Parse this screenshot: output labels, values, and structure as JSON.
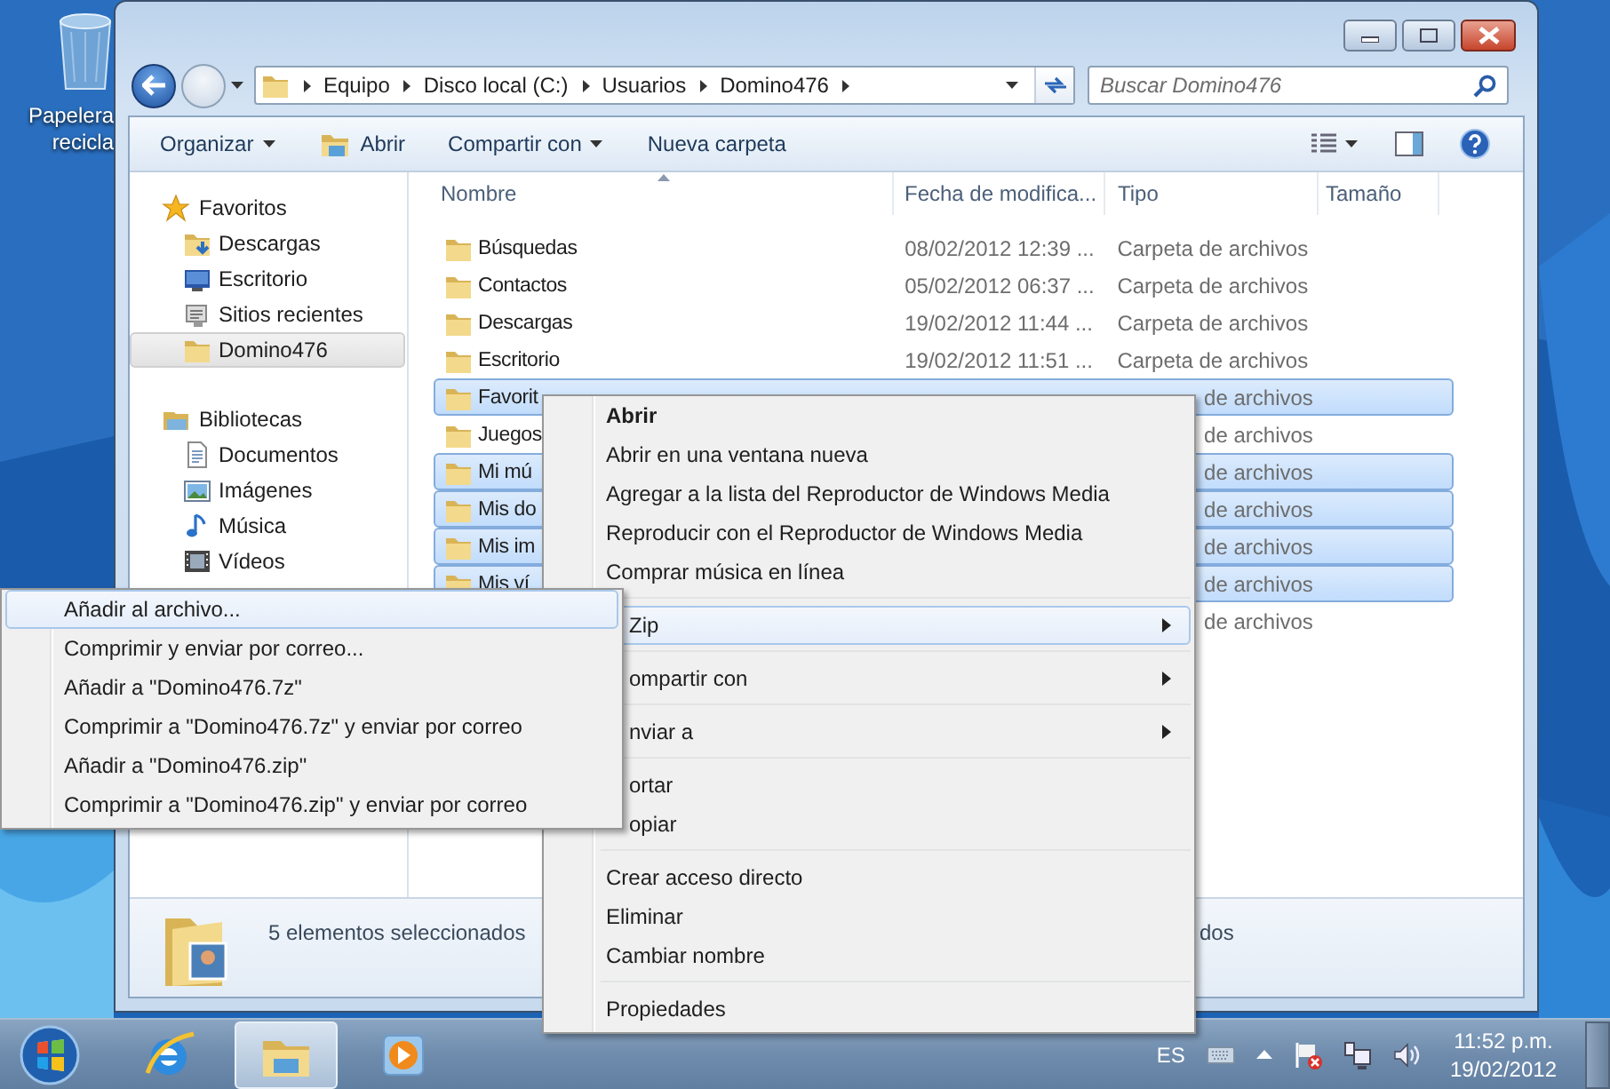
{
  "desktop": {
    "icons": [
      {
        "label": "Papelera recicla"
      }
    ]
  },
  "window": {
    "address": {
      "crumbs": [
        "Equipo",
        "Disco local (C:)",
        "Usuarios",
        "Domino476"
      ]
    },
    "search": {
      "placeholder": "Buscar Domino476"
    },
    "toolbar": [
      {
        "label": "Organizar",
        "kind": "menu"
      },
      {
        "label": "Abrir",
        "kind": "open"
      },
      {
        "label": "Compartir con",
        "kind": "menu"
      },
      {
        "label": "Nueva carpeta",
        "kind": "plain"
      }
    ],
    "sidebar": {
      "groups": [
        {
          "label": "Favoritos",
          "kind": "favorites",
          "items": [
            {
              "label": "Descargas",
              "kind": "downloads",
              "selected": false
            },
            {
              "label": "Escritorio",
              "kind": "desktop",
              "selected": false
            },
            {
              "label": "Sitios recientes",
              "kind": "recent",
              "selected": false
            },
            {
              "label": "Domino476",
              "kind": "folder",
              "selected": true
            }
          ]
        },
        {
          "label": "Bibliotecas",
          "kind": "libraries",
          "items": [
            {
              "label": "Documentos",
              "kind": "documents",
              "selected": false
            },
            {
              "label": "Imágenes",
              "kind": "pictures",
              "selected": false
            },
            {
              "label": "Música",
              "kind": "music",
              "selected": false
            },
            {
              "label": "Vídeos",
              "kind": "videos",
              "selected": false
            }
          ]
        }
      ]
    },
    "table": {
      "columns": [
        "Nombre",
        "Fecha de modifica...",
        "Tipo",
        "Tamaño"
      ],
      "rows": [
        {
          "name": "Búsquedas",
          "date": "08/02/2012 12:39 ...",
          "type": "Carpeta de archivos",
          "selected": false,
          "covered": false
        },
        {
          "name": "Contactos",
          "date": "05/02/2012 06:37 ...",
          "type": "Carpeta de archivos",
          "selected": false,
          "covered": false
        },
        {
          "name": "Descargas",
          "date": "19/02/2012 11:44 ...",
          "type": "Carpeta de archivos",
          "selected": false,
          "covered": false
        },
        {
          "name": "Escritorio",
          "date": "19/02/2012 11:51 ...",
          "type": "Carpeta de archivos",
          "selected": false,
          "covered": false
        },
        {
          "name": "Favorit",
          "type": "de archivos",
          "selected": true,
          "covered": true
        },
        {
          "name": "Juegos",
          "type": "de archivos",
          "selected": false,
          "covered": true
        },
        {
          "name": "Mi mú",
          "type": "de archivos",
          "selected": true,
          "covered": true
        },
        {
          "name": "Mis do",
          "type": "de archivos",
          "selected": true,
          "covered": true
        },
        {
          "name": "Mis im",
          "type": "de archivos",
          "selected": true,
          "covered": true
        },
        {
          "name": "Mis ví",
          "type": "de archivos",
          "selected": true,
          "covered": true
        },
        {
          "type": "de archivos",
          "selected": false,
          "covered": true
        }
      ]
    },
    "details": {
      "texts": [
        "5 elementos seleccionados",
        "dos"
      ]
    }
  },
  "context_menu": {
    "groups": [
      [
        {
          "label": "Abrir",
          "bold": true,
          "selected": false,
          "submenu": false,
          "covered": false
        },
        {
          "label": "Abrir en una ventana nueva",
          "bold": false,
          "selected": false,
          "submenu": false,
          "covered": false
        },
        {
          "label": "Agregar a la lista del Reproductor de Windows Media",
          "bold": false,
          "selected": false,
          "submenu": false,
          "covered": false
        },
        {
          "label": "Reproducir con el Reproductor de Windows Media",
          "bold": false,
          "selected": false,
          "submenu": false,
          "covered": false
        },
        {
          "label": "Comprar música en línea",
          "bold": false,
          "selected": false,
          "submenu": false,
          "covered": false
        }
      ],
      [
        {
          "label": "Zip",
          "bold": false,
          "selected": true,
          "submenu": true,
          "covered": true
        }
      ],
      [
        {
          "label": "ompartir con",
          "bold": false,
          "selected": false,
          "submenu": true,
          "covered": true
        }
      ],
      [
        {
          "label": "nviar a",
          "bold": false,
          "selected": false,
          "submenu": true,
          "covered": true
        }
      ],
      [
        {
          "label": "ortar",
          "bold": false,
          "selected": false,
          "submenu": false,
          "covered": true
        },
        {
          "label": "opiar",
          "bold": false,
          "selected": false,
          "submenu": false,
          "covered": true
        }
      ],
      [
        {
          "label": "Crear acceso directo",
          "bold": false,
          "selected": false,
          "submenu": false,
          "covered": false
        },
        {
          "label": "Eliminar",
          "bold": false,
          "selected": false,
          "submenu": false,
          "covered": false
        },
        {
          "label": "Cambiar nombre",
          "bold": false,
          "selected": false,
          "submenu": false,
          "covered": false
        }
      ],
      [
        {
          "label": "Propiedades",
          "bold": false,
          "selected": false,
          "submenu": false,
          "covered": false
        }
      ]
    ]
  },
  "submenu": {
    "items": [
      {
        "label": "Añadir al archivo...",
        "selected": true
      },
      {
        "label": "Comprimir y enviar por correo...",
        "selected": false
      },
      {
        "label": "Añadir a \"Domino476.7z\"",
        "selected": false
      },
      {
        "label": "Comprimir a \"Domino476.7z\" y enviar por correo",
        "selected": false
      },
      {
        "label": "Añadir a \"Domino476.zip\"",
        "selected": false
      },
      {
        "label": "Comprimir a \"Domino476.zip\" y enviar por correo",
        "selected": false
      }
    ]
  },
  "taskbar": {
    "apps": [
      {
        "kind": "browser",
        "selected": false
      },
      {
        "kind": "explorer",
        "selected": true
      },
      {
        "kind": "media",
        "selected": false
      }
    ],
    "tray": {
      "language": "ES",
      "time": "11:52 p.m.",
      "date": "19/02/2012"
    }
  }
}
